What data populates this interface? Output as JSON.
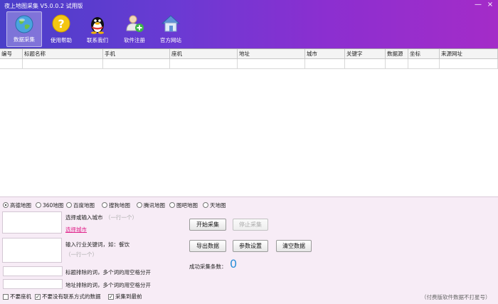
{
  "window": {
    "title": "夜上地图采集 V5.0.0.2 试用版",
    "min_glyph": "—",
    "close_glyph": "×"
  },
  "toolbar": [
    {
      "label": "数据采集",
      "icon": "globe-icon"
    },
    {
      "label": "使用帮助",
      "icon": "help-icon"
    },
    {
      "label": "联系我们",
      "icon": "qq-penguin-icon"
    },
    {
      "label": "软件注册",
      "icon": "user-add-icon"
    },
    {
      "label": "官方网站",
      "icon": "home-icon"
    }
  ],
  "grid": {
    "columns": [
      "编号",
      "标题名称",
      "手机",
      "座机",
      "地址",
      "城市",
      "关键字",
      "数据源",
      "坐标",
      "来源网址"
    ]
  },
  "map_sources": [
    {
      "label": "高德地图",
      "selected": true
    },
    {
      "label": "360地图",
      "selected": false
    },
    {
      "label": "百度地图",
      "selected": false
    },
    {
      "label": "搜狗地图",
      "selected": false
    },
    {
      "label": "腾讯地图",
      "selected": false
    },
    {
      "label": "图吧地图",
      "selected": false
    },
    {
      "label": "天地图",
      "selected": false
    }
  ],
  "form": {
    "city_label": "选择或输入城市",
    "city_hint": "（一行一个）",
    "city_link": "选择城市",
    "keyword_label": "输入行业关键词，如：餐饮",
    "keyword_hint": "（一行一个）",
    "title_exclude_label": "标题排除的词，多个词的用空格分开",
    "address_exclude_label": "地址排除的词，多个词的用空格分开"
  },
  "buttons": {
    "start": "开始采集",
    "stop": "停止采集",
    "export": "导出数据",
    "settings": "参数设置",
    "clear": "清空数据"
  },
  "status": {
    "count_label": "成功采集条数：",
    "count_value": "0"
  },
  "options": [
    {
      "label": "不要座机",
      "checked": false
    },
    {
      "label": "不要没有联系方式的数据",
      "checked": true
    },
    {
      "label": "采集到最前",
      "checked": true
    }
  ],
  "footer_note": "（付费版软件数据不打星号）",
  "colors": {
    "header_start": "#4a3fc9",
    "header_end": "#a42cc8",
    "panel_bg": "#f7ecf6",
    "link": "#e0228a",
    "count": "#2a8fd8"
  }
}
